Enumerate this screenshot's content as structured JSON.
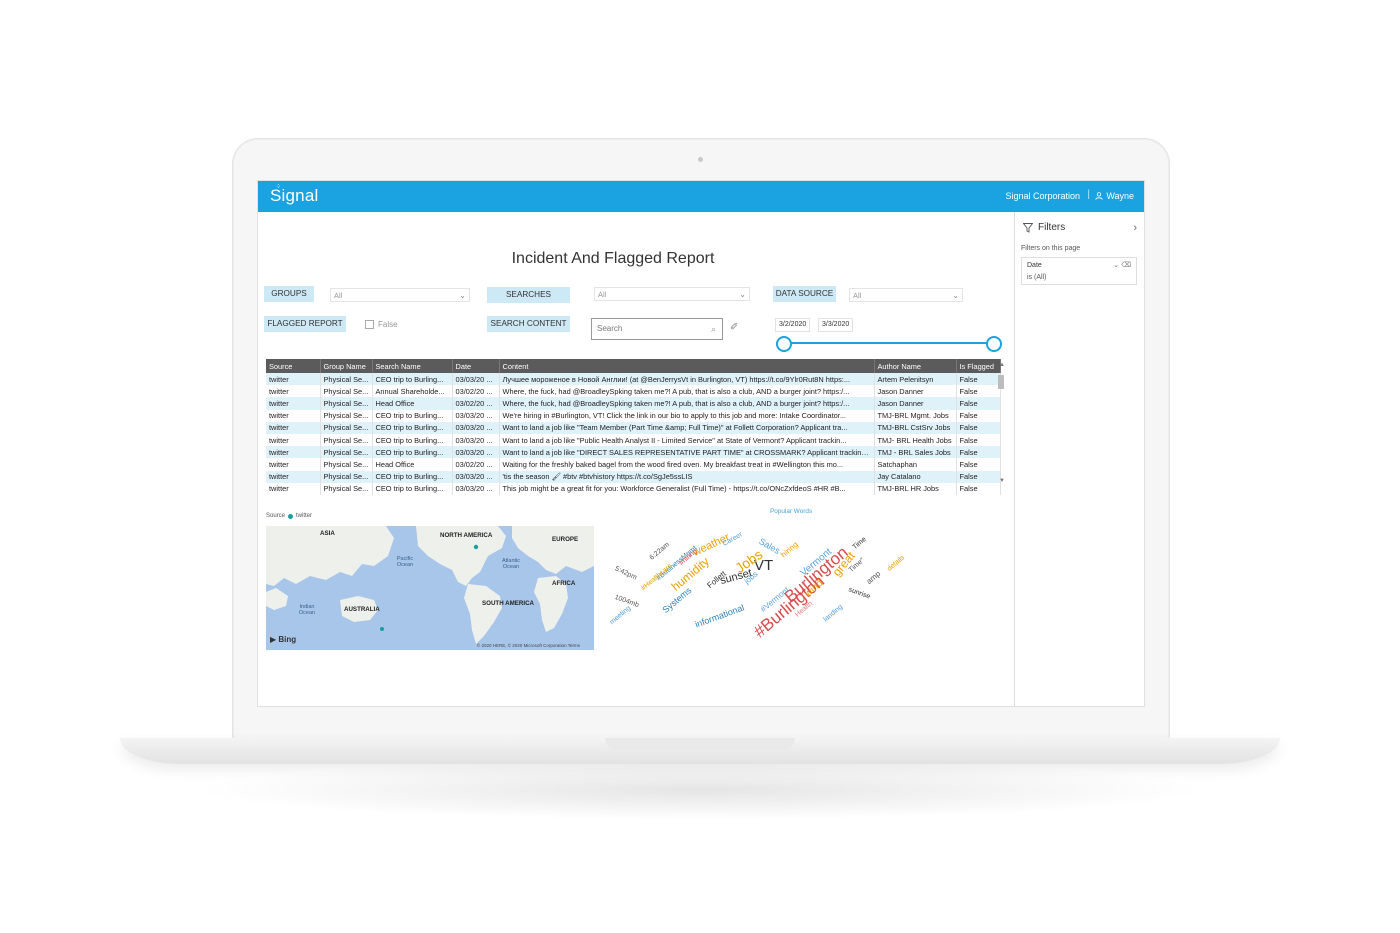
{
  "app": {
    "logo": "Signal",
    "organization": "Signal Corporation",
    "user": "Wayne",
    "accent_color": "#1aa3e0"
  },
  "report": {
    "title": "Incident And Flagged Report"
  },
  "filters_row": {
    "groups_label": "GROUPS",
    "groups_value": "All",
    "searches_label": "SEARCHES",
    "searches_value": "All",
    "data_source_label": "DATA SOURCE",
    "data_source_value": "All",
    "flagged_report_label": "FLAGGED REPORT",
    "flagged_checkbox_label": "False",
    "search_content_label": "SEARCH CONTENT",
    "search_placeholder": "Search",
    "date_start": "3/2/2020",
    "date_end": "3/3/2020"
  },
  "table": {
    "columns": [
      "Source",
      "Group Name",
      "Search Name",
      "Date",
      "Content",
      "Author Name",
      "Is Flagged"
    ],
    "rows": [
      [
        "twitter",
        "Physical Se...",
        "CEO trip to Burling...",
        "03/03/20 ...",
        "Лучшее мороженое в Новой Англии! (at @BenJerrysVt in Burlington, VT) https://t.co/9Ylr0Rut8N https:...",
        "Artem Pelenitsyn",
        "False"
      ],
      [
        "twitter",
        "Physical Se...",
        "Annual Shareholde...",
        "03/02/20 ...",
        "Where, the fuck, had @BroadleySpking taken me?! A pub, that is also a club, AND a burger joint? https:/...",
        "Jason Danner",
        "False"
      ],
      [
        "twitter",
        "Physical Se...",
        "Head Office",
        "03/02/20 ...",
        "Where, the fuck, had @BroadleySpking taken me?! A pub, that is also a club, AND a burger joint? https:/...",
        "Jason Danner",
        "False"
      ],
      [
        "twitter",
        "Physical Se...",
        "CEO trip to Burling...",
        "03/03/20 ...",
        "We're hiring in #Burlington, VT! Click the link in our bio to apply to this job and more: Intake Coordinator...",
        "TMJ-BRL Mgmt. Jobs",
        "False"
      ],
      [
        "twitter",
        "Physical Se...",
        "CEO trip to Burling...",
        "03/03/20 ...",
        "Want to land a job like \"Team Member (Part Time &amp; Full Time)\" at Follett Corporation? Applicant tra...",
        "TMJ-BRL CstSrv Jobs",
        "False"
      ],
      [
        "twitter",
        "Physical Se...",
        "CEO trip to Burling...",
        "03/03/20 ...",
        "Want to land a job like \"Public Health Analyst II - Limited Service\" at State of Vermont? Applicant trackin...",
        "TMJ- BRL Health Jobs",
        "False"
      ],
      [
        "twitter",
        "Physical Se...",
        "CEO trip to Burling...",
        "03/03/20 ...",
        "Want to land a job like \"DIRECT SALES REPRESENTATIVE PART TIME\" at CROSSMARK? Applicant tracking ...",
        "TMJ - BRL Sales Jobs",
        "False"
      ],
      [
        "twitter",
        "Physical Se...",
        "Head Office",
        "03/02/20 ...",
        "Waiting for the freshly baked bagel from the wood fired oven. My breakfast treat in #Wellington this mo...",
        "Satchaphan",
        "False"
      ],
      [
        "twitter",
        "Physical Se...",
        "CEO trip to Burling...",
        "03/03/20 ...",
        "'tis the season 🖌 #btv #btvhistory https://t.co/SgJe5ssLIS",
        "Jay Catalano",
        "False"
      ],
      [
        "twitter",
        "Physical Se...",
        "CEO trip to Burling...",
        "03/03/20 ...",
        "This job might be a great fit for you: Workforce Generalist (Full Time) - https://t.co/ONcZxfdeoS #HR #B...",
        "TMJ-BRL HR Jobs",
        "False"
      ]
    ]
  },
  "map": {
    "legend_title": "Source",
    "legend_item": "twitter",
    "legend_color": "#1a9e9e",
    "labels": {
      "asia": "ASIA",
      "north_america": "NORTH AMERICA",
      "europe": "EUROPE",
      "pacific": "Pacific Ocean",
      "atlantic": "Atlantic Ocean",
      "africa": "AFRICA",
      "indian": "Indian Ocean",
      "australia": "AUSTRALIA",
      "south_america": "SOUTH AMERICA"
    },
    "bing": "Bing",
    "copyright": "© 2020 HERE, © 2020 Microsoft Corporation Terms"
  },
  "word_cloud": {
    "title": "Popular Words",
    "words": [
      "#Burlington",
      "Burlington",
      "VT",
      "sunset",
      "Jobs",
      "Vermont",
      "weather",
      "humidity",
      "#Vermont",
      "Sales",
      "hiring",
      "great",
      "landing",
      "Systems",
      "informational",
      "Follett",
      "meeting",
      "1004mb",
      "5:42pm",
      "6:22am",
      "Career",
      "Time",
      "wind",
      "sunrise",
      "jobs",
      "Health",
      "#BusinessMgmt",
      "#Healthcare",
      "#hiring",
      "amp",
      "Time\"",
      "details"
    ]
  },
  "filters_pane": {
    "title": "Filters",
    "subtitle": "Filters on this page",
    "filter_name": "Date",
    "filter_value": "is (All)"
  }
}
